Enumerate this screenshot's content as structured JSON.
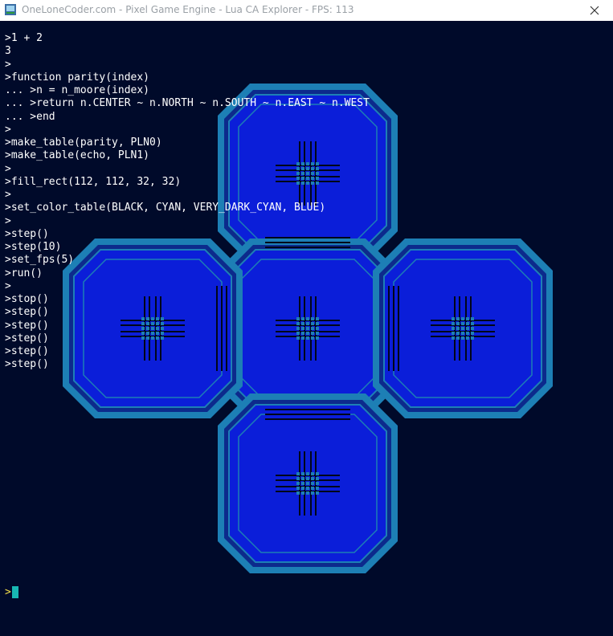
{
  "window": {
    "title": "OneLoneCoder.com - Pixel Game Engine - Lua CA Explorer - FPS: 113",
    "icon": "app-icon",
    "close_icon": "close-icon"
  },
  "colors": {
    "background": "#000a2a",
    "outer_ring": "#1d7fb5",
    "inner_ring": "#0c2a8c",
    "fill": "#0b1ed9",
    "cursor": "#18b7b2",
    "prompt": "#f5e04a"
  },
  "console": {
    "lines": [
      ">1 + 2",
      "3",
      ">",
      ">function parity(index)",
      "... >n = n_moore(index)",
      "... >return n.CENTER ~ n.NORTH ~ n.SOUTH ~ n.EAST ~ n.WEST",
      "... >end",
      ">",
      ">make_table(parity, PLN0)",
      ">make_table(echo, PLN1)",
      ">",
      ">fill_rect(112, 112, 32, 32)",
      ">",
      ">set_color_table(BLACK, CYAN, VERY_DARK_CYAN, BLUE)",
      ">",
      ">step()",
      ">step(10)",
      ">set_fps(5)",
      ">run()",
      ">",
      ">stop()",
      ">step()",
      ">step()",
      ">step()",
      ">step()",
      ">step()"
    ],
    "prompt": ">",
    "input_value": ""
  }
}
